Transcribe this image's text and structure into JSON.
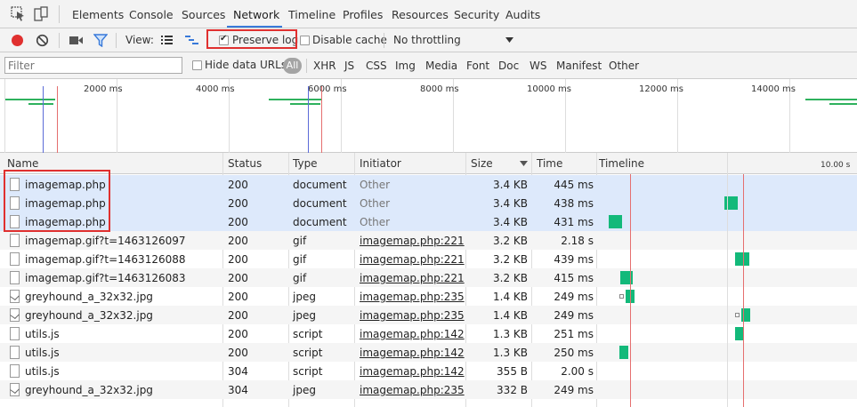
{
  "tabs": [
    "Elements",
    "Console",
    "Sources",
    "Network",
    "Timeline",
    "Profiles",
    "Resources",
    "Security",
    "Audits"
  ],
  "active_tab": "Network",
  "toolbar": {
    "view_label": "View:",
    "preserve_log": "Preserve log",
    "preserve_log_checked": true,
    "disable_cache": "Disable cache",
    "disable_cache_checked": false,
    "throttling": "No throttling"
  },
  "filter": {
    "placeholder": "Filter",
    "hide_data_urls": "Hide data URLs",
    "all_label": "All",
    "types": [
      "XHR",
      "JS",
      "CSS",
      "Img",
      "Media",
      "Font",
      "Doc",
      "WS",
      "Manifest",
      "Other"
    ]
  },
  "overview": {
    "tick_labels": [
      "2000 ms",
      "4000 ms",
      "6000 ms",
      "8000 ms",
      "10000 ms",
      "12000 ms",
      "14000 ms"
    ]
  },
  "table": {
    "headers": {
      "name": "Name",
      "status": "Status",
      "type": "Type",
      "initiator": "Initiator",
      "size": "Size",
      "time": "Time",
      "timeline": "Timeline",
      "timeline_tick": "10.00 s"
    },
    "rows": [
      {
        "name": "imagemap.php",
        "status": "200",
        "type": "document",
        "initiator": "Other",
        "size": "3.4 KB",
        "time": "445 ms",
        "icon": "document-icon",
        "selected": true
      },
      {
        "name": "imagemap.php",
        "status": "200",
        "type": "document",
        "initiator": "Other",
        "size": "3.4 KB",
        "time": "438 ms",
        "icon": "document-icon",
        "selected": true
      },
      {
        "name": "imagemap.php",
        "status": "200",
        "type": "document",
        "initiator": "Other",
        "size": "3.4 KB",
        "time": "431 ms",
        "icon": "document-icon",
        "selected": true
      },
      {
        "name": "imagemap.gif?t=1463126097",
        "status": "200",
        "type": "gif",
        "initiator": "imagemap.php:221",
        "size": "3.2 KB",
        "time": "2.18 s",
        "icon": "document-icon",
        "selected": false
      },
      {
        "name": "imagemap.gif?t=1463126088",
        "status": "200",
        "type": "gif",
        "initiator": "imagemap.php:221",
        "size": "3.2 KB",
        "time": "439 ms",
        "icon": "document-icon",
        "selected": false
      },
      {
        "name": "imagemap.gif?t=1463126083",
        "status": "200",
        "type": "gif",
        "initiator": "imagemap.php:221",
        "size": "3.2 KB",
        "time": "415 ms",
        "icon": "document-icon",
        "selected": false
      },
      {
        "name": "greyhound_a_32x32.jpg",
        "status": "200",
        "type": "jpeg",
        "initiator": "imagemap.php:235",
        "size": "1.4 KB",
        "time": "249 ms",
        "icon": "image-icon",
        "selected": false
      },
      {
        "name": "greyhound_a_32x32.jpg",
        "status": "200",
        "type": "jpeg",
        "initiator": "imagemap.php:235",
        "size": "1.4 KB",
        "time": "249 ms",
        "icon": "image-icon",
        "selected": false
      },
      {
        "name": "utils.js",
        "status": "200",
        "type": "script",
        "initiator": "imagemap.php:142",
        "size": "1.3 KB",
        "time": "251 ms",
        "icon": "document-icon",
        "selected": false
      },
      {
        "name": "utils.js",
        "status": "200",
        "type": "script",
        "initiator": "imagemap.php:142",
        "size": "1.3 KB",
        "time": "250 ms",
        "icon": "document-icon",
        "selected": false
      },
      {
        "name": "utils.js",
        "status": "304",
        "type": "script",
        "initiator": "imagemap.php:142",
        "size": "355 B",
        "time": "2.00 s",
        "icon": "document-icon",
        "selected": false
      },
      {
        "name": "greyhound_a_32x32.jpg",
        "status": "304",
        "type": "jpeg",
        "initiator": "imagemap.php:235",
        "size": "332 B",
        "time": "249 ms",
        "icon": "image-icon",
        "selected": false
      }
    ]
  },
  "colors": {
    "record_red": "#e0302f",
    "selected_row": "#dde9fb",
    "timeline_green": "#13b97a",
    "overview_green": "#2eb15d",
    "accent_blue": "#3879d9"
  }
}
